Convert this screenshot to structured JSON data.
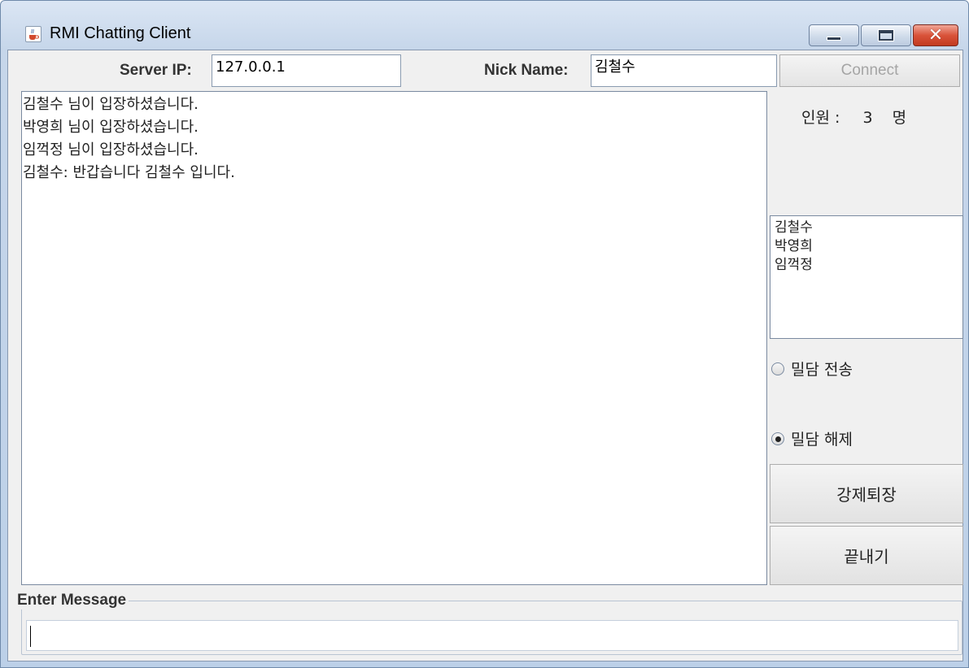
{
  "window": {
    "title": "RMI Chatting Client",
    "icon": "java-cup-icon"
  },
  "connection": {
    "server_ip_label": "Server IP:",
    "server_ip_value": "127.0.0.1",
    "nickname_label": "Nick Name:",
    "nickname_value": "김철수",
    "connect_label": "Connect"
  },
  "chat": {
    "messages": [
      "김철수 님이 입장하셨습니다.",
      "박영희 님이 입장하셨습니다.",
      "임꺽정 님이 입장하셨습니다.",
      "김철수: 반갑습니다 김철수 입니다."
    ]
  },
  "sidebar": {
    "count_label": "인원 :",
    "count_value": "3",
    "count_unit": "명",
    "users": [
      "김철수",
      "박영희",
      "임꺽정"
    ],
    "radio_whisper_send": "밀담 전송",
    "radio_whisper_release": "밀담 해제",
    "kick_label": "강제퇴장",
    "exit_label": "끝내기"
  },
  "message_box": {
    "legend": "Enter Message",
    "value": ""
  }
}
